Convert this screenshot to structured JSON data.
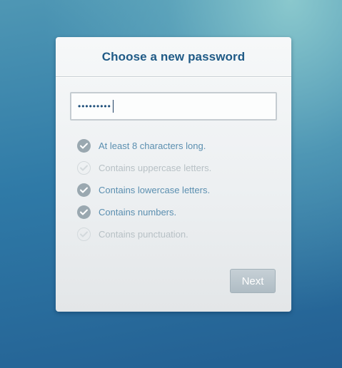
{
  "dialog": {
    "title": "Choose a new password",
    "password_value": "•••••••••"
  },
  "requirements": [
    {
      "label": "At least 8 characters long.",
      "met": true
    },
    {
      "label": "Contains uppercase letters.",
      "met": false
    },
    {
      "label": "Contains lowercase letters.",
      "met": true
    },
    {
      "label": "Contains numbers.",
      "met": true
    },
    {
      "label": "Contains punctuation.",
      "met": false
    }
  ],
  "actions": {
    "next_label": "Next"
  },
  "colors": {
    "title": "#1f5a86",
    "met_text": "#5b8fb0",
    "unmet_text": "#b7c0c5",
    "check_met": "#9aa8b0",
    "button_bg": "#b8c4cb"
  },
  "icons": {
    "requirement": "checkmark-icon"
  }
}
